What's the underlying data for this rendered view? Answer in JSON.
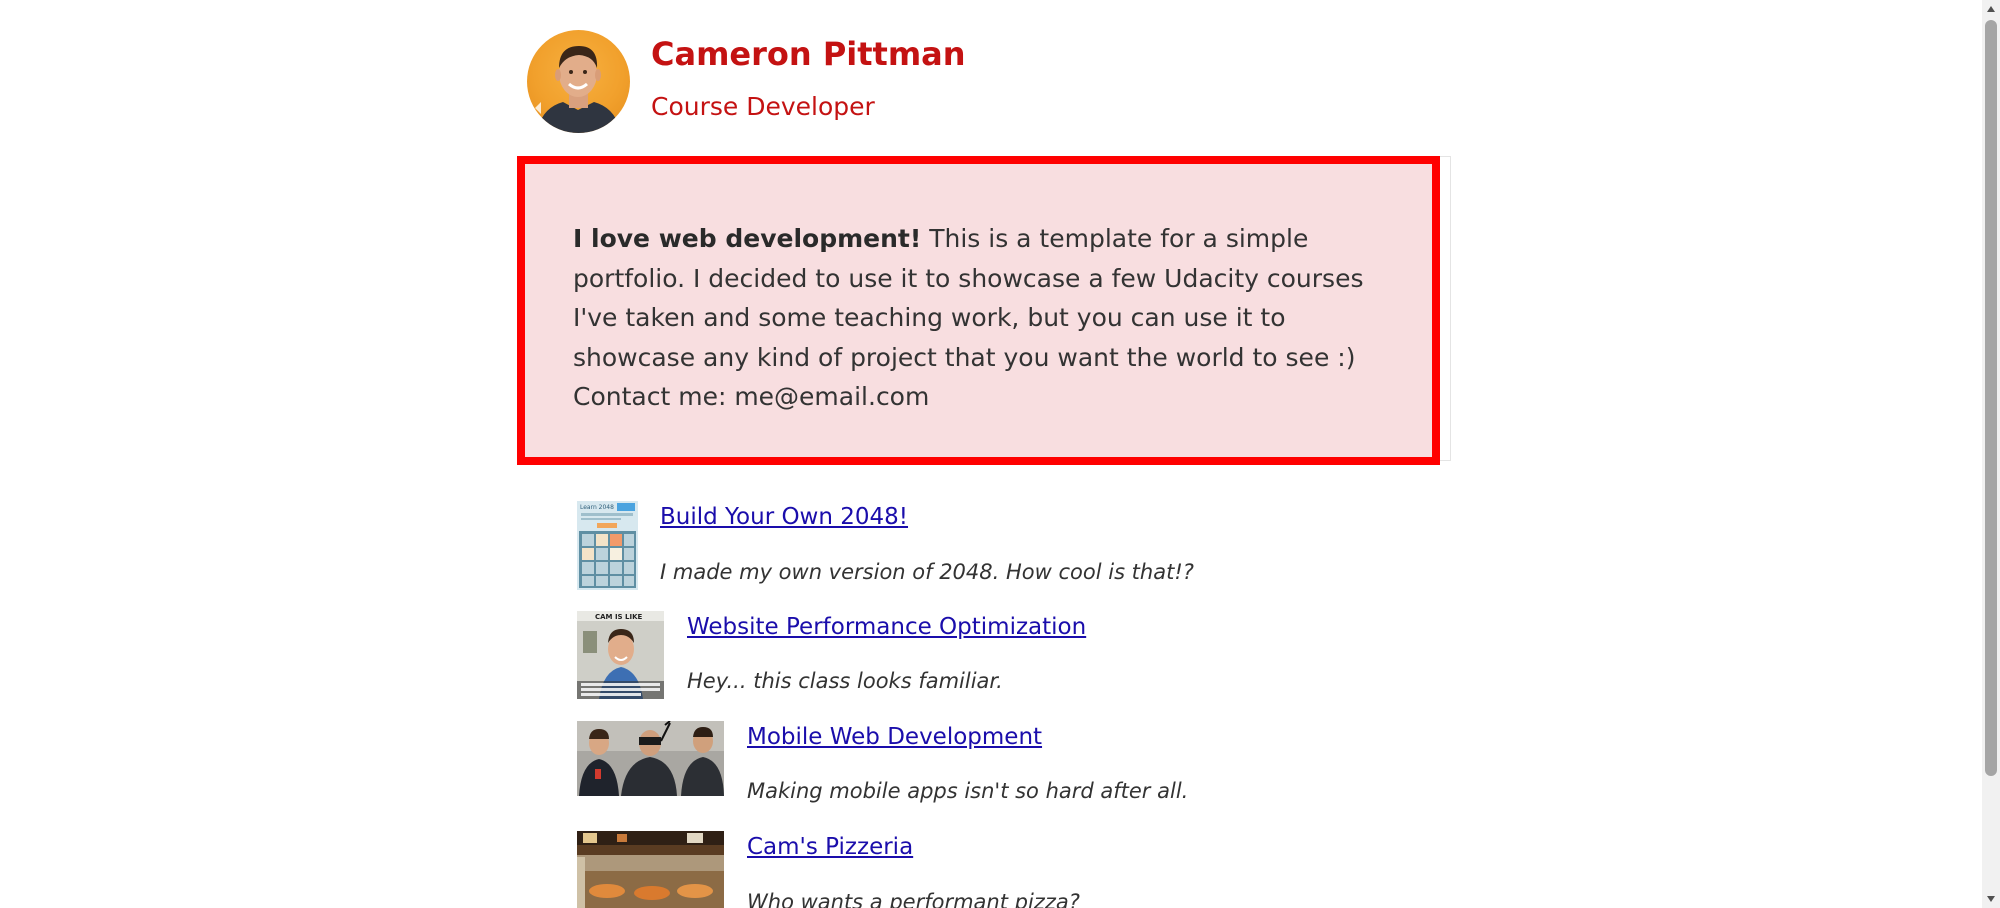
{
  "header": {
    "name": "Cameron Pittman",
    "role": "Course Developer"
  },
  "intro": {
    "bold_lead": "I love web development!",
    "body": " This is a template for a simple portfolio. I decided to use it to showcase a few Udacity courses I've taken and some teaching work, but you can use it to showcase any kind of project that you want the world to see :)",
    "contact": "Contact me: me@email.com"
  },
  "projects": [
    {
      "title": "Build Your Own 2048!",
      "description": "I made my own version of 2048. How cool is that!?",
      "thumb_caption": "Learn 2048"
    },
    {
      "title": "Website Performance Optimization",
      "description": "Hey... this class looks familiar.",
      "thumb_caption": "CAM IS LIKE"
    },
    {
      "title": "Mobile Web Development",
      "description": "Making mobile apps isn't so hard after all."
    },
    {
      "title": "Cam's Pizzeria",
      "description": "Who wants a performant pizza?"
    }
  ],
  "colors": {
    "accent": "#c41212",
    "highlight_border": "#ff0000",
    "highlight_bg": "#f8dee0",
    "link": "#1a0dab"
  },
  "icons": {
    "scroll_up": "chevron-up-icon",
    "scroll_down": "chevron-down-icon"
  }
}
